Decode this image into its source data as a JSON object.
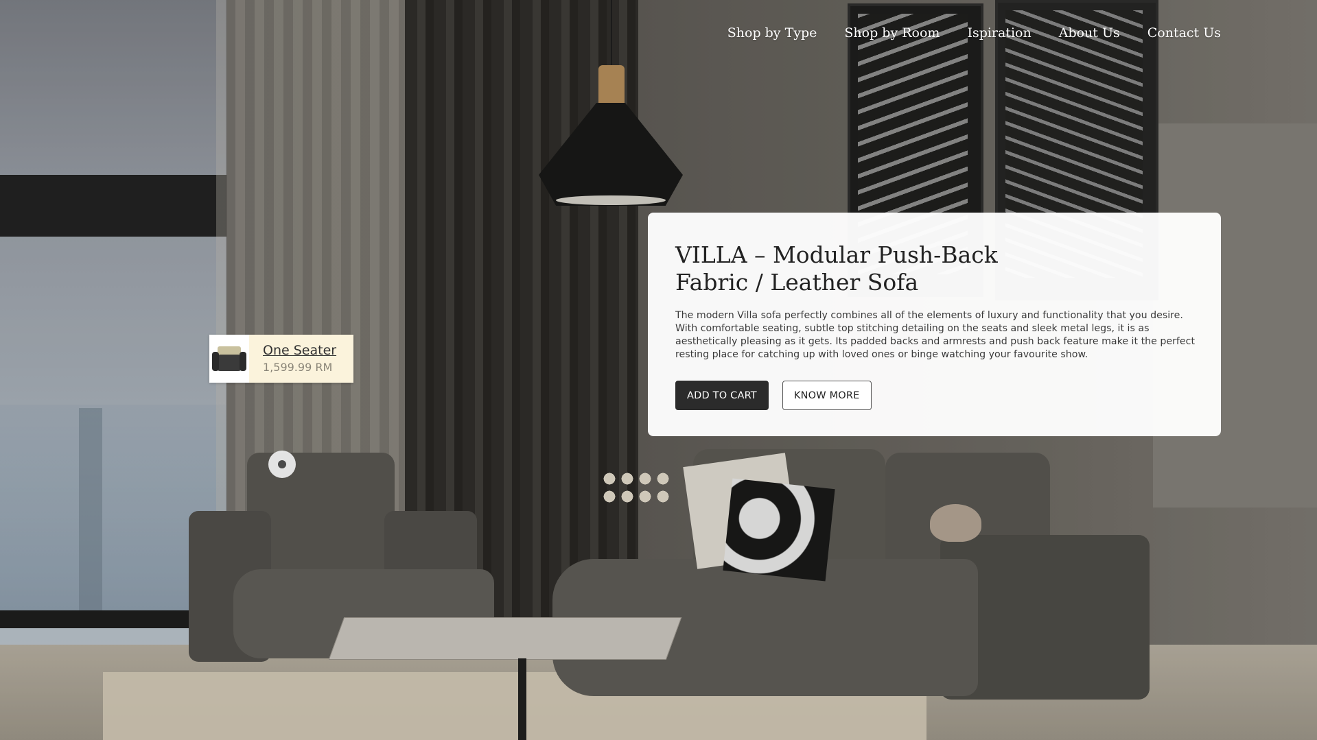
{
  "nav": {
    "items": [
      {
        "label": "Shop by Type"
      },
      {
        "label": "Shop by Room"
      },
      {
        "label": "Ispiration"
      },
      {
        "label": "About Us"
      },
      {
        "label": "Contact Us"
      }
    ]
  },
  "product": {
    "title_line1": "VILLA – Modular Push-Back",
    "title_line2": "Fabric / Leather Sofa",
    "description": "The modern Villa sofa perfectly combines all of the elements of luxury and functionality that you desire. With comfortable seating, subtle top stitching detailing on the seats and sleek metal legs, it is as aesthetically pleasing as it gets. Its padded backs and armrests and push back feature make it the perfect resting place for catching up with loved ones or binge watching your favourite show.",
    "add_to_cart_label": "ADD TO CART",
    "know_more_label": "KNOW MORE"
  },
  "hotspot": {
    "name": "One Seater",
    "price": "1,599.99 RM",
    "thumbnail_icon": "armchair-icon"
  },
  "colors": {
    "card_bg": "#ffffff",
    "primary_button": "#2b2b2b",
    "hotspot_card_bg": "#fbf3dc"
  }
}
